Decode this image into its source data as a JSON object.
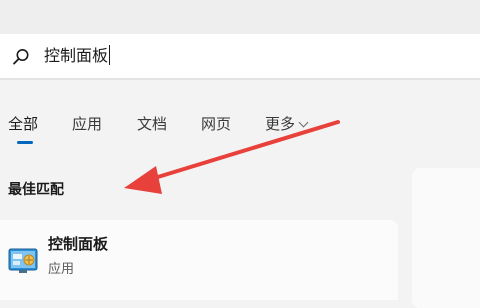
{
  "search": {
    "query": "控制面板"
  },
  "tabs": [
    {
      "label": "全部",
      "active": true
    },
    {
      "label": "应用",
      "active": false
    },
    {
      "label": "文档",
      "active": false
    },
    {
      "label": "网页",
      "active": false
    },
    {
      "label": "更多",
      "active": false,
      "has_dropdown": true
    }
  ],
  "best_match": {
    "heading": "最佳匹配",
    "result": {
      "title": "控制面板",
      "subtitle": "应用",
      "icon": "control-panel-icon"
    }
  },
  "annotation": {
    "type": "arrow",
    "color": "#e8403a"
  },
  "colors": {
    "accent": "#0067c0",
    "background": "#f3f3f3"
  }
}
